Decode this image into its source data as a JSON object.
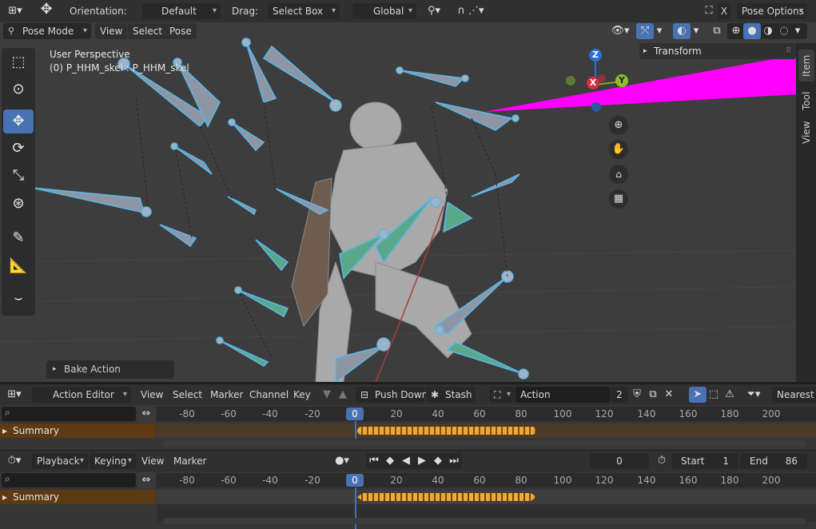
{
  "top_header": {
    "orientation_label": "Orientation:",
    "orientation_value": "Default",
    "drag_label": "Drag:",
    "drag_value": "Select Box",
    "transform_space": "Global",
    "close_x": "X",
    "pose_options": "Pose Options"
  },
  "viewport_header": {
    "mode": "Pose Mode",
    "menus": [
      "View",
      "Select",
      "Pose"
    ]
  },
  "viewport": {
    "perspective": "User Perspective",
    "object_info": "(0) P_HHM_skel : P_HHM_skel",
    "gizmo_z": "Z",
    "gizmo_x": "X",
    "gizmo_y": "Y",
    "transform_panel": "Transform",
    "side_tabs": [
      "Item",
      "Tool",
      "View"
    ],
    "operator_panel": "Bake Action"
  },
  "action_editor": {
    "editor_mode": "Action Editor",
    "menus": [
      "View",
      "Select",
      "Marker",
      "Channel",
      "Key"
    ],
    "push_down": "Push Down",
    "stash": "Stash",
    "action_label": "Action",
    "users": "2",
    "snap": "Nearest",
    "summary": "Summary",
    "current_frame": "0",
    "ticks": [
      "-80",
      "-60",
      "-40",
      "-20",
      "0",
      "20",
      "40",
      "60",
      "80",
      "100",
      "120",
      "140",
      "160",
      "180",
      "200"
    ]
  },
  "timeline": {
    "playback": "Playback",
    "keying": "Keying",
    "menus": [
      "View",
      "Marker"
    ],
    "frame_field": "0",
    "start_label": "Start",
    "start_value": "1",
    "end_label": "End",
    "end_value": "86",
    "summary": "Summary",
    "current_frame": "0",
    "ticks": [
      "-80",
      "-60",
      "-40",
      "-20",
      "0",
      "20",
      "40",
      "60",
      "80",
      "100",
      "120",
      "140",
      "160",
      "180",
      "200"
    ]
  },
  "colors": {
    "accent": "#4772b3",
    "summary_bg": "#5d3a12",
    "keyframe": "#f0a838",
    "magenta": "#ff00ff",
    "bone_blue": "#5bb6e6",
    "bone_green": "#5aa88a"
  }
}
